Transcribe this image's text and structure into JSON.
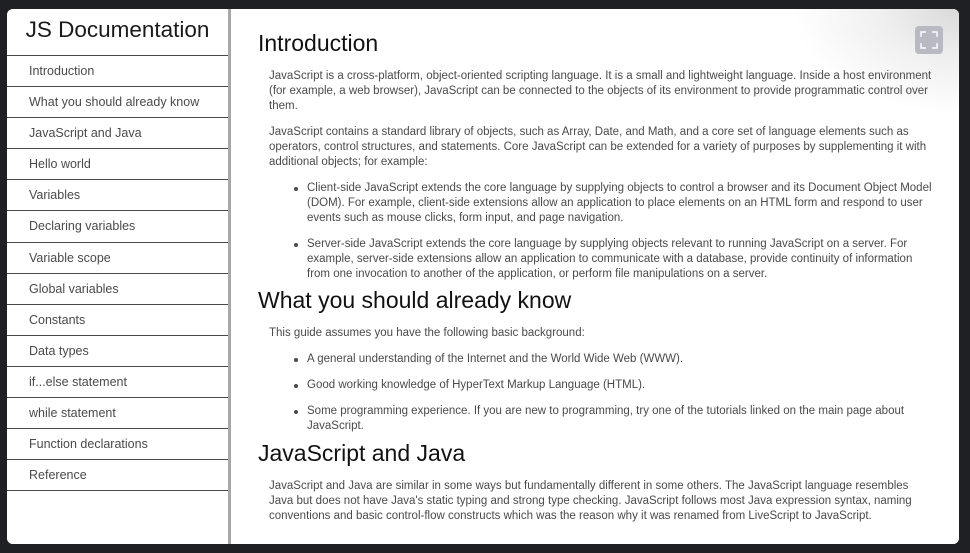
{
  "sidebar": {
    "title": "JS Documentation",
    "items": [
      {
        "label": "Introduction"
      },
      {
        "label": "What you should already know"
      },
      {
        "label": "JavaScript and Java"
      },
      {
        "label": "Hello world"
      },
      {
        "label": "Variables"
      },
      {
        "label": "Declaring variables"
      },
      {
        "label": "Variable scope"
      },
      {
        "label": "Global variables"
      },
      {
        "label": "Constants"
      },
      {
        "label": "Data types"
      },
      {
        "label": "if...else statement"
      },
      {
        "label": "while statement"
      },
      {
        "label": "Function declarations"
      },
      {
        "label": "Reference"
      }
    ]
  },
  "main": {
    "fullscreen_icon": "expand-icon",
    "sections": [
      {
        "title": "Introduction",
        "p1": "JavaScript is a cross-platform, object-oriented scripting language. It is a small and lightweight language. Inside a host environment (for example, a web browser), JavaScript can be connected to the objects of its environment to provide programmatic control over them.",
        "p2": "JavaScript contains a standard library of objects, such as Array, Date, and Math, and a core set of language elements such as operators, control structures, and statements. Core JavaScript can be extended for a variety of purposes by supplementing it with additional objects; for example:",
        "bullets": [
          "Client-side JavaScript extends the core language by supplying objects to control a browser and its Document Object Model (DOM). For example, client-side extensions allow an application to place elements on an HTML form and respond to user events such as mouse clicks, form input, and page navigation.",
          "Server-side JavaScript extends the core language by supplying objects relevant to running JavaScript on a server. For example, server-side extensions allow an application to communicate with a database, provide continuity of information from one invocation to another of the application, or perform file manipulations on a server."
        ]
      },
      {
        "title": "What you should already know",
        "p1": "This guide assumes you have the following basic background:",
        "bullets": [
          "A general understanding of the Internet and the World Wide Web (WWW).",
          "Good working knowledge of HyperText Markup Language (HTML).",
          "Some programming experience. If you are new to programming, try one of the tutorials linked on the main page about JavaScript."
        ]
      },
      {
        "title": "JavaScript and Java",
        "p1": "JavaScript and Java are similar in some ways but fundamentally different in some others. The JavaScript language resembles Java but does not have Java's static typing and strong type checking. JavaScript follows most Java expression syntax, naming conventions and basic control-flow constructs which was the reason why it was renamed from LiveScript to JavaScript."
      }
    ]
  }
}
